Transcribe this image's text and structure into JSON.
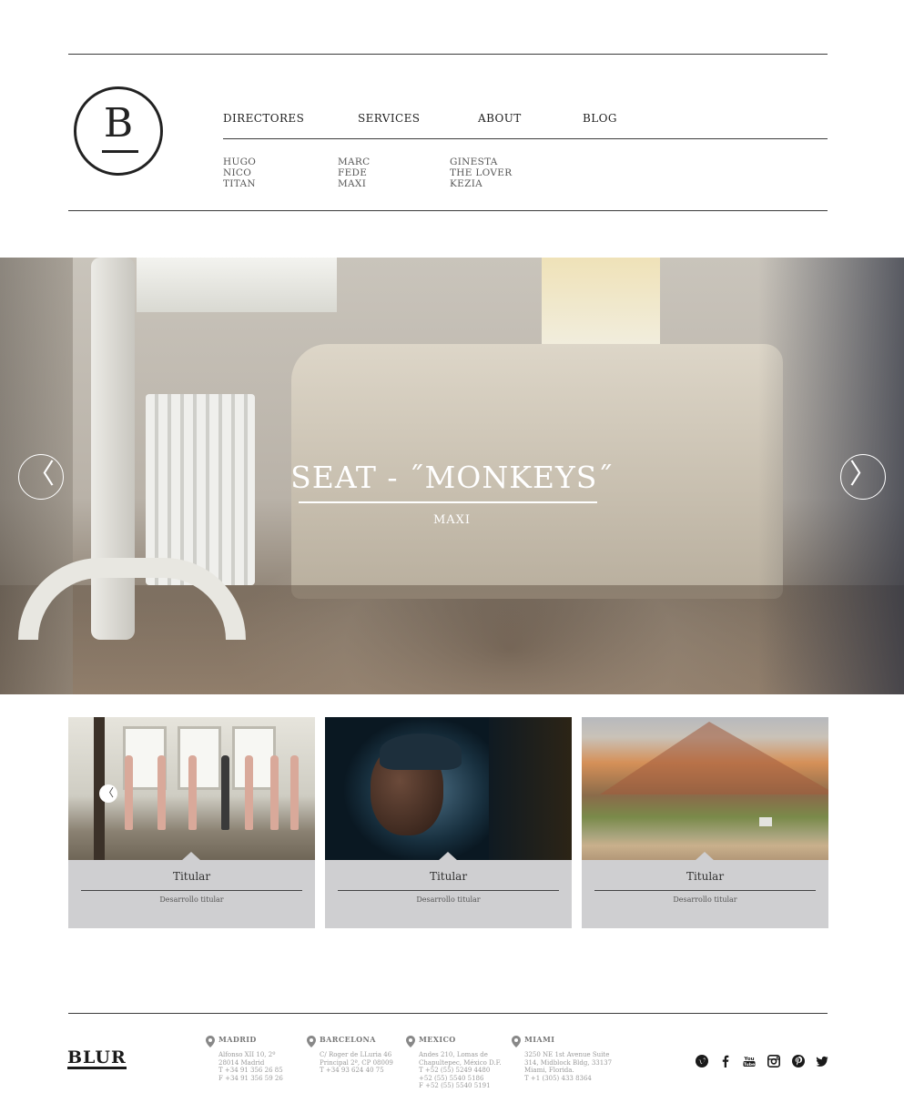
{
  "brand": {
    "logo_letter": "B",
    "footer_logo": "BLUR"
  },
  "nav": {
    "items": [
      {
        "label": "DIRECTORES"
      },
      {
        "label": "SERVICES"
      },
      {
        "label": "ABOUT"
      },
      {
        "label": "BLOG"
      }
    ],
    "directors_columns": [
      [
        "HUGO",
        "NICO",
        "TITAN"
      ],
      [
        "MARC",
        "FEDE",
        "MAXI"
      ],
      [
        "GINESTA",
        "THE LOVER",
        "KEZIA"
      ]
    ]
  },
  "hero": {
    "title": "SEAT - ˝MONKEYS˝",
    "director": "MAXI",
    "prev_glyph": "〈",
    "next_glyph": "〉"
  },
  "cards": [
    {
      "title": "Titular",
      "subtitle": "Desarrollo titular",
      "prev_glyph": "〈"
    },
    {
      "title": "Titular",
      "subtitle": "Desarrollo titular"
    },
    {
      "title": "Titular",
      "subtitle": "Desarrollo titular"
    }
  ],
  "offices": [
    {
      "city": "MADRID",
      "lines": [
        "Alfonso XII 10, 2º",
        "28014 Madrid",
        "T +34 91 356 26 85",
        "F +34 91 356 59 26"
      ]
    },
    {
      "city": "BARCELONA",
      "lines": [
        "C/ Roger de LLuria 46",
        "Principal 2ª, CP 08009",
        "T +34 93 624 40 75"
      ]
    },
    {
      "city": "MEXICO",
      "lines": [
        "Andes 210, Lomas de",
        "Chapultepec, México D.F.",
        "T +52 (55) 5249 4480",
        "+52 (55) 5540 5186",
        "F +52 (55) 5540 5191"
      ]
    },
    {
      "city": "MIAMI",
      "lines": [
        "3250 NE 1st Avenue Suite",
        "314, Midblock Bldg, 33137",
        "Miami, Florida.",
        "T +1 (305) 433 8364"
      ]
    }
  ],
  "social": [
    {
      "icon": "vimeo-icon"
    },
    {
      "icon": "facebook-icon"
    },
    {
      "icon": "youtube-icon",
      "glyph": "You Tube"
    },
    {
      "icon": "instagram-icon"
    },
    {
      "icon": "pinterest-icon"
    },
    {
      "icon": "twitter-icon"
    }
  ],
  "colors": {
    "text_dark": "#1f1f1f",
    "card_bg": "#cfcfd1",
    "rule": "#3a3a3a",
    "hero_text": "#ffffff"
  }
}
